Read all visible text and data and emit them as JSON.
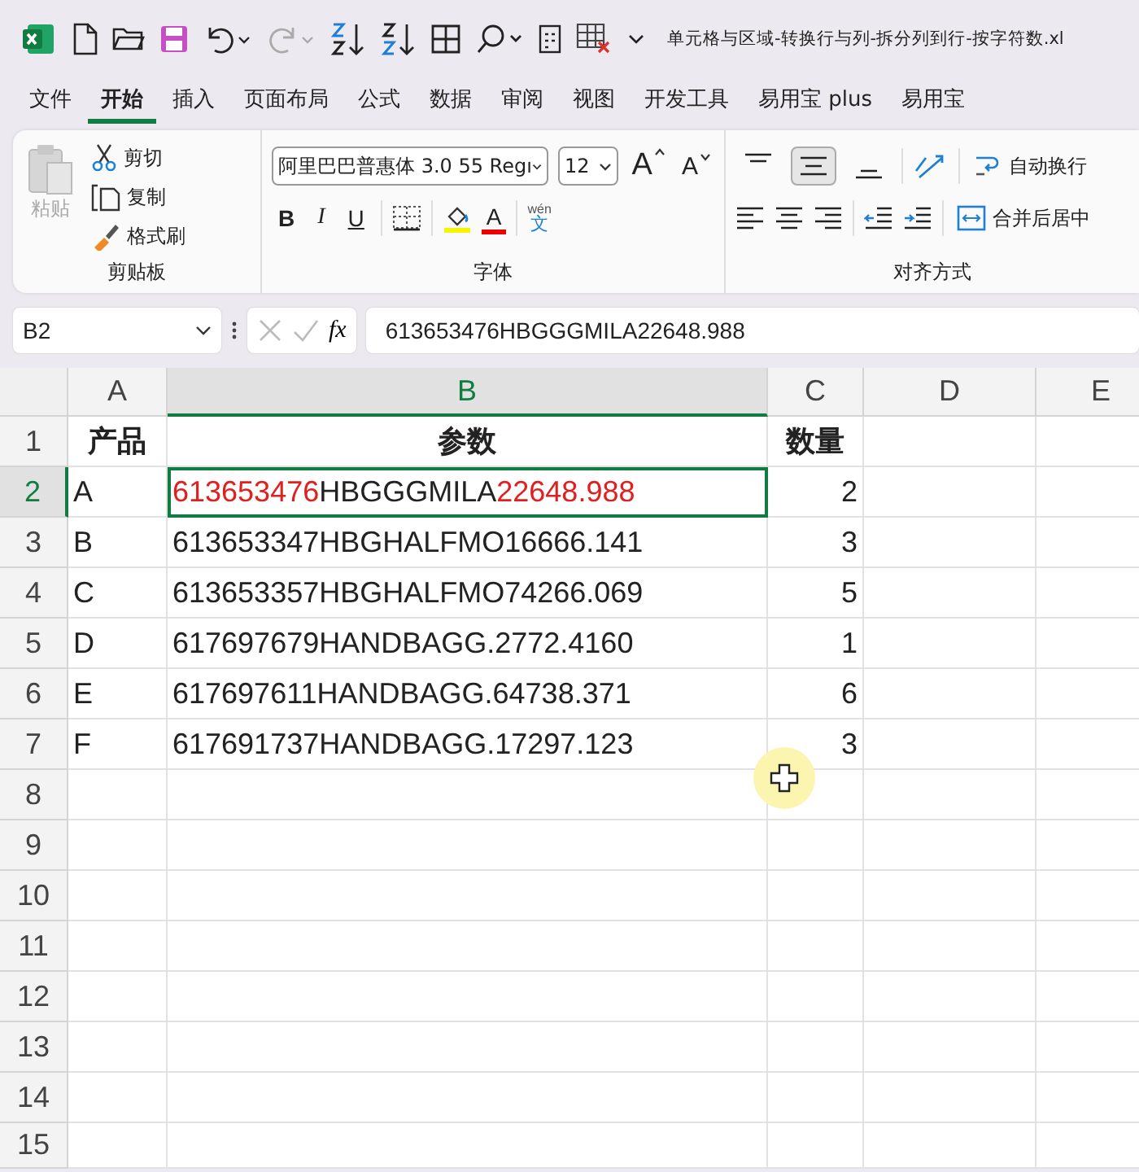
{
  "title_bar": {
    "file_title": "单元格与区域-转换行与列-拆分列到行-按字符数.xl"
  },
  "menu_tabs": [
    {
      "label": "文件",
      "selected": false
    },
    {
      "label": "开始",
      "selected": true
    },
    {
      "label": "插入",
      "selected": false
    },
    {
      "label": "页面布局",
      "selected": false
    },
    {
      "label": "公式",
      "selected": false
    },
    {
      "label": "数据",
      "selected": false
    },
    {
      "label": "审阅",
      "selected": false
    },
    {
      "label": "视图",
      "selected": false
    },
    {
      "label": "开发工具",
      "selected": false
    },
    {
      "label": "易用宝 plus",
      "selected": false
    },
    {
      "label": "易用宝",
      "selected": false
    }
  ],
  "ribbon": {
    "clipboard": {
      "paste": {
        "label": "粘贴",
        "disabled": true
      },
      "cut": "剪切",
      "copy": "复制",
      "format_painter": "格式刷",
      "group_label": "剪贴板"
    },
    "font": {
      "font_name": "阿里巴巴普惠体 3.0 55 Regı",
      "font_size": "12",
      "grow": "A",
      "shrink": "A",
      "bold": "B",
      "italic": "I",
      "underline": "U",
      "font_color": "A",
      "phonetic": "wén",
      "phonetic_char": "文",
      "group_label": "字体"
    },
    "alignment": {
      "vertical_align": [
        {
          "selected": false
        },
        {
          "selected": true
        },
        {
          "selected": false
        }
      ],
      "wrap_text": "自动换行",
      "merge_center": "合并后居中",
      "group_label": "对齐方式"
    }
  },
  "formula_bar": {
    "name_box": "B2",
    "fx": "fx",
    "formula": "613653476HBGGGMILA22648.988"
  },
  "sheet": {
    "columns": [
      {
        "label": "A",
        "selected": false
      },
      {
        "label": "B",
        "selected": true
      },
      {
        "label": "C",
        "selected": false
      },
      {
        "label": "D",
        "selected": false
      },
      {
        "label": "E",
        "selected": false
      }
    ],
    "rows": [
      {
        "number": "1",
        "selected": false,
        "kind": "header",
        "cells": [
          {
            "parts": [
              {
                "text": "产品",
                "highlighted": false
              }
            ],
            "selected": false
          },
          {
            "parts": [
              {
                "text": "参数",
                "highlighted": false
              }
            ],
            "selected": false
          },
          {
            "parts": [
              {
                "text": "数量",
                "highlighted": false
              }
            ],
            "selected": false
          }
        ]
      },
      {
        "number": "2",
        "selected": true,
        "kind": "data",
        "cells": [
          {
            "parts": [
              {
                "text": "A",
                "highlighted": false
              }
            ],
            "selected": false
          },
          {
            "parts": [
              {
                "text": "613653476",
                "highlighted": true
              },
              {
                "text": "HBGGGMILA",
                "highlighted": false
              },
              {
                "text": "22648.988",
                "highlighted": true
              }
            ],
            "selected": true
          },
          {
            "parts": [
              {
                "text": "2",
                "highlighted": false
              }
            ],
            "selected": false
          }
        ]
      },
      {
        "number": "3",
        "selected": false,
        "kind": "data",
        "cells": [
          {
            "parts": [
              {
                "text": "B",
                "highlighted": false
              }
            ],
            "selected": false
          },
          {
            "parts": [
              {
                "text": "613653347HBGHALFMO16666.141",
                "highlighted": false
              }
            ],
            "selected": false
          },
          {
            "parts": [
              {
                "text": "3",
                "highlighted": false
              }
            ],
            "selected": false
          }
        ]
      },
      {
        "number": "4",
        "selected": false,
        "kind": "data",
        "cells": [
          {
            "parts": [
              {
                "text": "C",
                "highlighted": false
              }
            ],
            "selected": false
          },
          {
            "parts": [
              {
                "text": "613653357HBGHALFMO74266.069",
                "highlighted": false
              }
            ],
            "selected": false
          },
          {
            "parts": [
              {
                "text": "5",
                "highlighted": false
              }
            ],
            "selected": false
          }
        ]
      },
      {
        "number": "5",
        "selected": false,
        "kind": "data",
        "cells": [
          {
            "parts": [
              {
                "text": "D",
                "highlighted": false
              }
            ],
            "selected": false
          },
          {
            "parts": [
              {
                "text": "617697679HANDBAGG.2772.4160",
                "highlighted": false
              }
            ],
            "selected": false
          },
          {
            "parts": [
              {
                "text": "1",
                "highlighted": false
              }
            ],
            "selected": false
          }
        ]
      },
      {
        "number": "6",
        "selected": false,
        "kind": "data",
        "cells": [
          {
            "parts": [
              {
                "text": "E",
                "highlighted": false
              }
            ],
            "selected": false
          },
          {
            "parts": [
              {
                "text": "617697611HANDBAGG.64738.371",
                "highlighted": false
              }
            ],
            "selected": false
          },
          {
            "parts": [
              {
                "text": "6",
                "highlighted": false
              }
            ],
            "selected": false
          }
        ]
      },
      {
        "number": "7",
        "selected": false,
        "kind": "data",
        "cells": [
          {
            "parts": [
              {
                "text": "F",
                "highlighted": false
              }
            ],
            "selected": false
          },
          {
            "parts": [
              {
                "text": "617691737HANDBAGG.17297.123",
                "highlighted": false
              }
            ],
            "selected": false
          },
          {
            "parts": [
              {
                "text": "3",
                "highlighted": false
              }
            ],
            "selected": false
          }
        ]
      },
      {
        "number": "8",
        "selected": false,
        "kind": "empty"
      },
      {
        "number": "9",
        "selected": false,
        "kind": "empty"
      },
      {
        "number": "10",
        "selected": false,
        "kind": "empty"
      },
      {
        "number": "11",
        "selected": false,
        "kind": "empty"
      },
      {
        "number": "12",
        "selected": false,
        "kind": "empty"
      },
      {
        "number": "13",
        "selected": false,
        "kind": "empty"
      },
      {
        "number": "14",
        "selected": false,
        "kind": "empty"
      },
      {
        "number": "15",
        "selected": false,
        "kind": "empty"
      }
    ]
  }
}
